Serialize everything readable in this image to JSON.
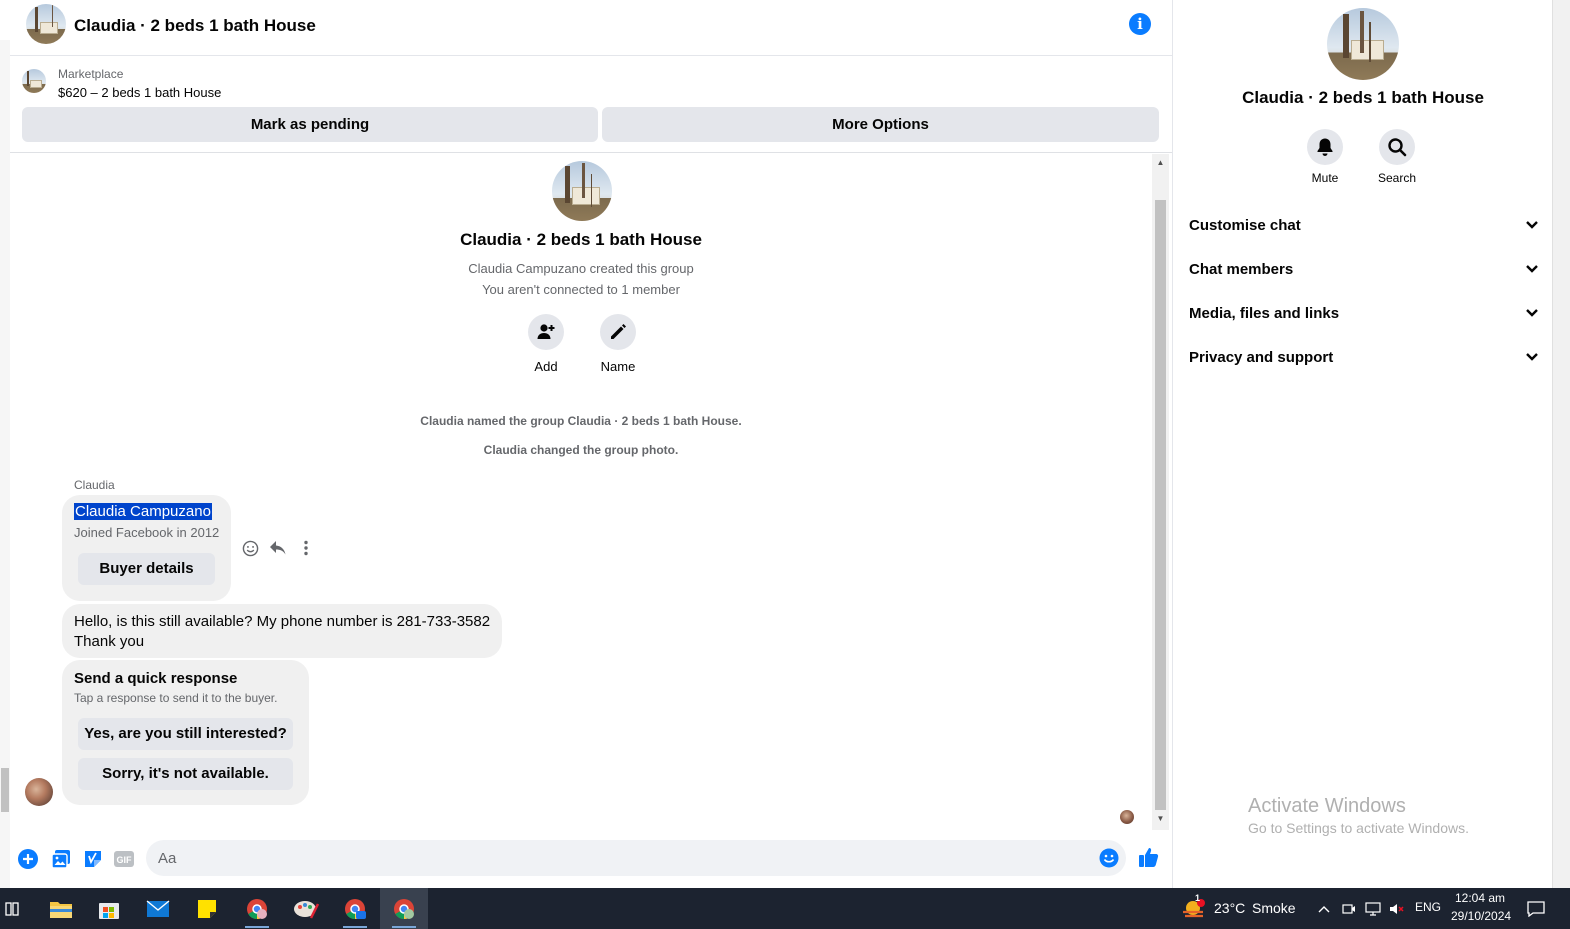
{
  "header": {
    "title": "Claudia · 2 beds 1 bath House"
  },
  "marketplace": {
    "label": "Marketplace",
    "listing": "$620 – 2 beds 1 bath House",
    "mark_pending": "Mark as pending",
    "more_options": "More Options"
  },
  "intro": {
    "title": "Claudia · 2 beds 1 bath House",
    "created": "Claudia Campuzano created this group",
    "connected": "You aren't connected to 1 member",
    "add_label": "Add",
    "name_label": "Name"
  },
  "system_messages": [
    "Claudia named the group Claudia · 2 beds 1 bath House.",
    "Claudia changed the group photo."
  ],
  "messages": {
    "sender": "Claudia",
    "card_name": "Claudia Campuzano",
    "card_joined": "Joined Facebook in 2012",
    "buyer_details": "Buyer details",
    "text_line1": "Hello, is this still available? My phone number is 281-733-3582",
    "text_line2": "Thank you",
    "quick_title": "Send a quick response",
    "quick_sub": "Tap a response to send it to the buyer.",
    "quick_yes": "Yes, are you still interested?",
    "quick_sorry": "Sorry, it's not available."
  },
  "composer": {
    "placeholder": "Aa",
    "gif_label": "GIF"
  },
  "panel": {
    "title": "Claudia · 2 beds 1 bath House",
    "mute": "Mute",
    "search": "Search",
    "sections": [
      "Customise chat",
      "Chat members",
      "Media, files and links",
      "Privacy and support"
    ]
  },
  "watermark": {
    "title": "Activate Windows",
    "sub": "Go to Settings to activate Windows."
  },
  "taskbar": {
    "weather_temp": "23°C",
    "weather_desc": "Smoke",
    "weather_badge": "1",
    "lang": "ENG",
    "time": "12:04 am",
    "date": "29/10/2024"
  },
  "colors": {
    "accent": "#0a7cff",
    "bubble": "#f0f0f0",
    "button": "#e4e6eb",
    "selection": "#0044cc"
  },
  "icons": [
    "info-icon",
    "add-person-icon",
    "pencil-icon",
    "emoji-icon",
    "reply-icon",
    "more-vertical-icon",
    "plus-icon",
    "photo-icon",
    "sticker-icon",
    "gif-icon",
    "like-icon",
    "bell-icon",
    "search-icon",
    "chevron-down-icon"
  ]
}
